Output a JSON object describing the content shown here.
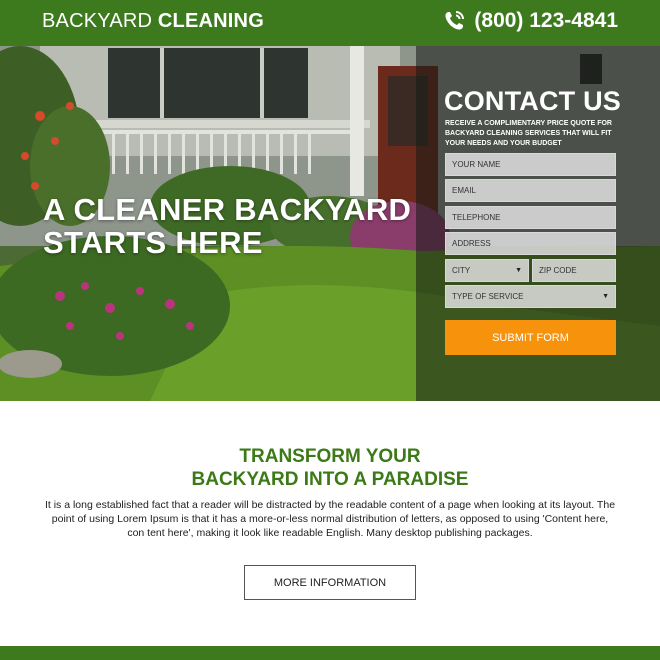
{
  "header": {
    "brand_light": "BACKYARD ",
    "brand_bold": "CLEANING",
    "phone": "(800) 123-4841"
  },
  "hero": {
    "title_line1": "A CLEANER BACKYARD",
    "title_line2": "STARTS HERE"
  },
  "contact": {
    "title": "CONTACT US",
    "description": "RECEIVE A COMPLIMENTARY PRICE QUOTE FOR BACKYARD CLEANING SERVICES THAT WILL FIT YOUR NEEDS AND YOUR BUDGET",
    "fields": {
      "name": "YOUR NAME",
      "email": "EMAIL",
      "telephone": "TELEPHONE",
      "address": "ADDRESS",
      "city": "CITY",
      "zip": "ZIP CODE",
      "service": "TYPE OF SERVICE"
    },
    "submit_label": "SUBMIT FORM"
  },
  "section": {
    "title_line1": "TRANSFORM YOUR",
    "title_line2": "BACKYARD INTO A PARADISE",
    "body": "It is a long established fact that a reader will be distracted by the readable content of a page when looking at its layout. The point of using Lorem Ipsum is that it has a more-or-less normal distribution of letters, as opposed to using 'Content here, con tent here', making it look like readable English. Many desktop publishing packages.",
    "button_label": "MORE INFORMATION"
  },
  "colors": {
    "brand_green": "#3c7a1d",
    "accent_orange": "#f7920c",
    "heading_green": "#3b7a17"
  },
  "icons": {
    "phone": "phone-icon",
    "dropdown": "chevron-down-icon"
  }
}
